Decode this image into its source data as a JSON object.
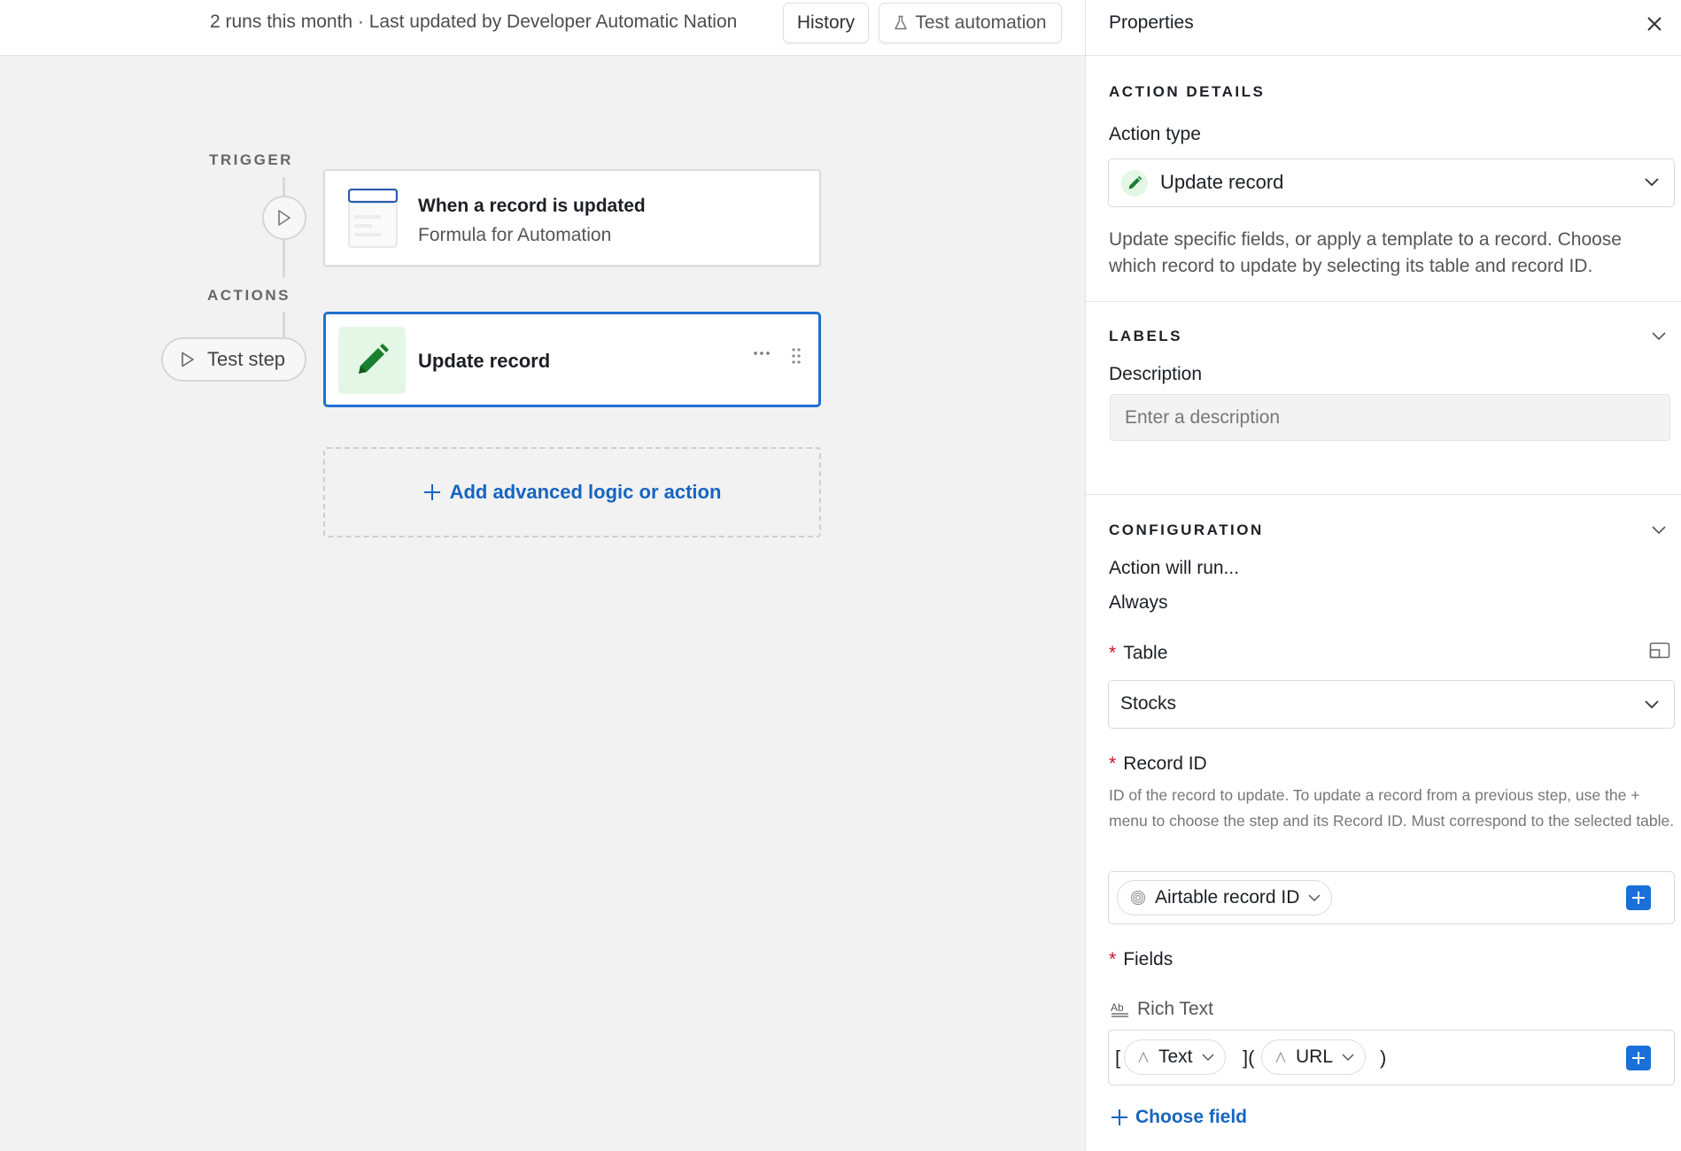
{
  "topbar": {
    "runs_text": "2 runs this month · Last updated by Developer Automatic Nation",
    "history_label": "History",
    "test_automation_label": "Test automation"
  },
  "canvas": {
    "trigger_label": "TRIGGER",
    "actions_label": "ACTIONS",
    "trigger_card": {
      "title": "When a record is updated",
      "subtitle": "Formula for Automation",
      "icon": "table-record-icon"
    },
    "test_step_label": "Test step",
    "action_card": {
      "title": "Update record",
      "icon": "pencil-icon",
      "more_icon": "more-horizontal-icon",
      "drag_icon": "drag-handle-icon"
    },
    "add_logic_label": "Add advanced logic or action"
  },
  "panel": {
    "title": "Properties",
    "action_details": {
      "heading": "ACTION DETAILS",
      "action_type_label": "Action type",
      "action_type_value": "Update record",
      "description": "Update specific fields, or apply a template to a record. Choose which record to update by selecting its table and record ID."
    },
    "labels": {
      "heading": "LABELS",
      "description_label": "Description",
      "description_placeholder": "Enter a description",
      "description_value": ""
    },
    "configuration": {
      "heading": "CONFIGURATION",
      "action_runs_label": "Action will run...",
      "action_runs_value": "Always",
      "table_label": "Table",
      "table_value": "Stocks",
      "record_id_label": "Record ID",
      "record_id_help": "ID of the record to update. To update a record from a previous step, use the + menu to choose the step and its Record ID. Must correspond to the selected table.",
      "record_id_token": "Airtable record ID",
      "fields_label": "Fields",
      "field_name": "Rich Text",
      "field_tokens": {
        "open_bracket": "[",
        "token1": "Text",
        "middle": "](",
        "token2": "URL",
        "close_paren": ")"
      },
      "choose_field_label": "Choose field",
      "required_marker": "*"
    }
  },
  "colors": {
    "accent_blue": "#1f6fd1",
    "link_blue": "#1664c0",
    "green_icon": "#1a7f2e",
    "green_bg": "#e4f6e6",
    "required_red": "#c8102e",
    "canvas_bg": "#f2f2f2"
  }
}
